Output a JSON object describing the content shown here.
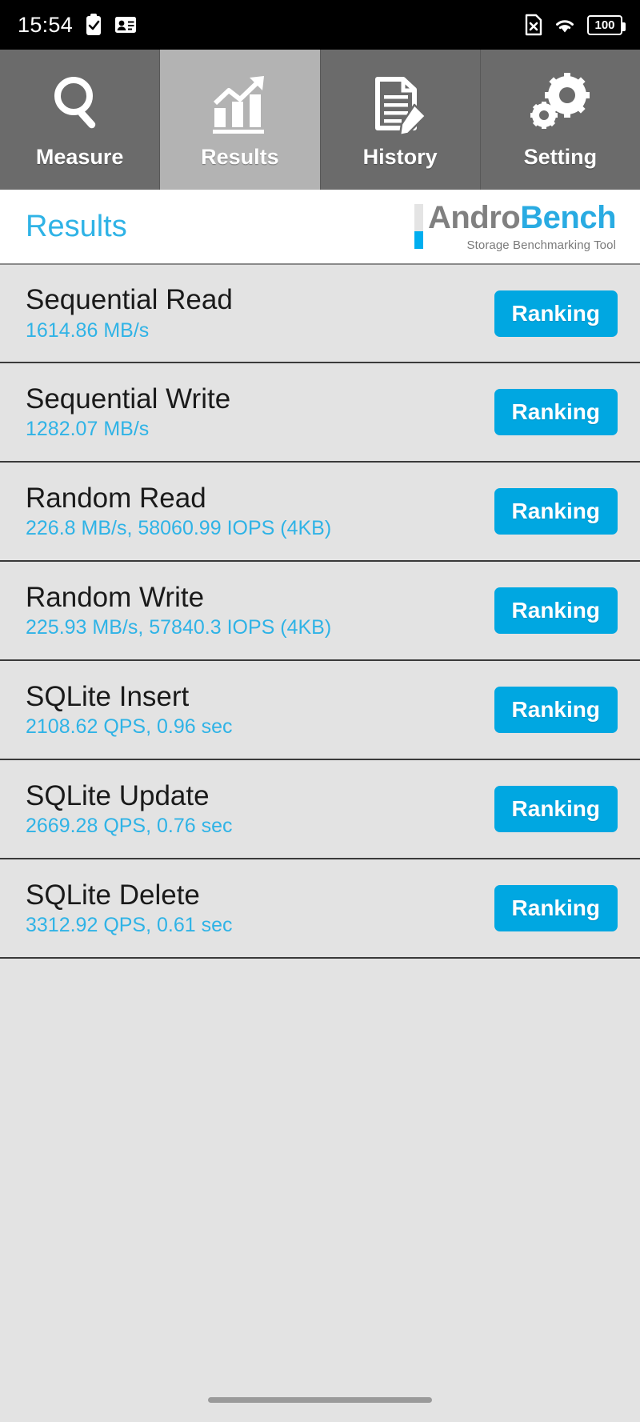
{
  "statusbar": {
    "time": "15:54",
    "left_icons": [
      "clipboard-check-icon",
      "contact-card-icon"
    ],
    "right_icons": [
      "sim-card-off-icon",
      "wifi-icon"
    ],
    "battery_level": "100"
  },
  "tabs": [
    {
      "label": "Measure",
      "icon": "magnifier-icon",
      "active": false
    },
    {
      "label": "Results",
      "icon": "bar-chart-trend-icon",
      "active": true
    },
    {
      "label": "History",
      "icon": "document-pencil-icon",
      "active": false
    },
    {
      "label": "Setting",
      "icon": "gears-icon",
      "active": false
    }
  ],
  "header": {
    "title": "Results",
    "logo_andro": "Andro",
    "logo_bench": "Bench",
    "logo_tagline": "Storage Benchmarking Tool"
  },
  "results": [
    {
      "name": "Sequential Read",
      "value": "1614.86 MB/s",
      "button": "Ranking"
    },
    {
      "name": "Sequential Write",
      "value": "1282.07 MB/s",
      "button": "Ranking"
    },
    {
      "name": "Random Read",
      "value": "226.8 MB/s, 58060.99 IOPS (4KB)",
      "button": "Ranking"
    },
    {
      "name": "Random Write",
      "value": "225.93 MB/s, 57840.3 IOPS (4KB)",
      "button": "Ranking"
    },
    {
      "name": "SQLite Insert",
      "value": "2108.62 QPS, 0.96 sec",
      "button": "Ranking"
    },
    {
      "name": "SQLite Update",
      "value": "2669.28 QPS, 0.76 sec",
      "button": "Ranking"
    },
    {
      "name": "SQLite Delete",
      "value": "3312.92 QPS, 0.61 sec",
      "button": "Ranking"
    }
  ],
  "colors": {
    "accent": "#00a7e1",
    "value_text": "#2fb3e6",
    "tab_inactive": "#6b6b6b",
    "tab_active": "#b3b3b3",
    "list_bg": "#e3e3e3"
  }
}
